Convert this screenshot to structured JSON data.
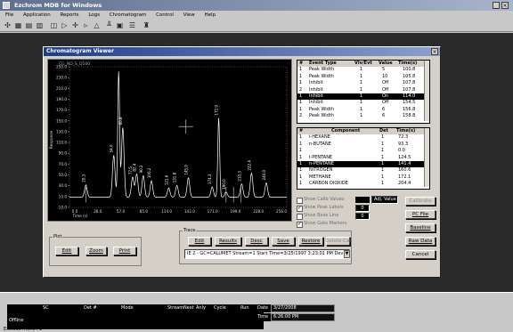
{
  "app": {
    "title": "Ezchrom MDB for Windows",
    "menu": [
      "File",
      "Application",
      "Reports",
      "Logs",
      "Chromatogram",
      "Control",
      "View",
      "Help"
    ]
  },
  "dialog": {
    "title": "Chromatogram Viewer",
    "plot_header": "CG_ND_S_D100",
    "y_label": "Response",
    "x_label": "Time (s)"
  },
  "chart_data": {
    "type": "line",
    "ylim": [
      -10,
      265
    ],
    "xlim": [
      0,
      265
    ],
    "y_ticks": [
      "250.0",
      "230.0",
      "210.0",
      "190.0",
      "170.0",
      "150.0",
      "130.0",
      "110.0",
      "90.0",
      "70.0",
      "50.0",
      "30.0",
      "10.0",
      "-10.0"
    ],
    "x_ticks": [
      "0.0",
      "28.0",
      "57.0",
      "85.0",
      "114.0",
      "142.0",
      "171.0",
      "199.0",
      "228.0",
      "256.0"
    ],
    "peaks": [
      {
        "x": 20,
        "y": 34,
        "label": "20.3"
      },
      {
        "x": 54,
        "y": 92,
        "label": "54.0"
      },
      {
        "x": 60,
        "y": 255,
        "label": ""
      },
      {
        "x": 65,
        "y": 146,
        "label": "60.8"
      },
      {
        "x": 77,
        "y": 49,
        "label": "77.5"
      },
      {
        "x": 82,
        "y": 55,
        "label": "82.4"
      },
      {
        "x": 90,
        "y": 52,
        "label": "90.2"
      },
      {
        "x": 100,
        "y": 42,
        "label": "100.2"
      },
      {
        "x": 121,
        "y": 28,
        "label": "121.6"
      },
      {
        "x": 131,
        "y": 33,
        "label": "131.8"
      },
      {
        "x": 145,
        "y": 48,
        "label": "145.9"
      },
      {
        "x": 174,
        "y": 30,
        "label": "174.3"
      },
      {
        "x": 182,
        "y": 165,
        "label": "172.9"
      },
      {
        "x": 191,
        "y": 20,
        "label": "190.0"
      },
      {
        "x": 210,
        "y": 36,
        "label": "210.3"
      },
      {
        "x": 222,
        "y": 57,
        "label": "222.4"
      },
      {
        "x": 240,
        "y": 38,
        "label": "240.0"
      }
    ],
    "markers_x": [
      20,
      191,
      200,
      209
    ],
    "crosshair": {
      "x": 142,
      "y": 148
    }
  },
  "events": {
    "headers": [
      "#",
      "Event Type",
      "Vlv/Evt",
      "Value",
      "Time(s)"
    ],
    "rows": [
      [
        "1",
        "Peak Width",
        "1",
        "5",
        "100.8"
      ],
      [
        "1",
        "Peak Width",
        "1",
        "10",
        "105.8"
      ],
      [
        "1",
        "Inhibit",
        "1",
        "Off",
        "107.8"
      ],
      [
        "2",
        "Inhibit",
        "1",
        "Off",
        "107.8"
      ],
      [
        "1",
        "Inhibit",
        "1",
        "On",
        "114.0"
      ],
      [
        "1",
        "Inhibit",
        "1",
        "Off",
        "154.5"
      ],
      [
        "1",
        "Peak Width",
        "1",
        "6",
        "156.8"
      ],
      [
        "2",
        "Peak Width",
        "1",
        "6",
        "158.8"
      ]
    ],
    "selected": 4
  },
  "components": {
    "headers": [
      "#",
      "Component",
      "Det",
      "Time(s)"
    ],
    "rows": [
      [
        "1",
        "i-HEXANE",
        "1",
        "72.3"
      ],
      [
        "1",
        "n-BUTANE",
        "1",
        "93.3"
      ],
      [
        "1",
        "",
        "1",
        "0.0"
      ],
      [
        "1",
        "i-PENTANE",
        "1",
        "124.5"
      ],
      [
        "1",
        "n-PENTANE",
        "1",
        "141.4"
      ],
      [
        "1",
        "NITROGEN",
        "1",
        "160.6"
      ],
      [
        "1",
        "METHANE",
        "1",
        "172.1"
      ],
      [
        "1",
        "CARBON DIOXIDE",
        "1",
        "204.4"
      ]
    ],
    "selected": 4
  },
  "options": [
    {
      "label": "Show Calib Values",
      "checked": false
    },
    {
      "label": "Show Peak Labels",
      "checked": true
    },
    {
      "label": "Show Base Line",
      "checked": false
    },
    {
      "label": "Show Gate Markers",
      "checked": true
    }
  ],
  "option_fields": {
    "range_label": "Adj. Value",
    "x_value": "0",
    "y_value": "0"
  },
  "side_buttons": [
    "Calibrate",
    "PC File",
    "Baseline",
    "Raw Data",
    "Cancel"
  ],
  "plot_group": {
    "label": "Plot",
    "buttons": [
      "Edit",
      "Zoom",
      "Print"
    ]
  },
  "trace_group": {
    "label": "Trace",
    "buttons": [
      "Edit",
      "Results",
      "Desc",
      "Save",
      "Restore",
      "Delete Cal"
    ],
    "selector": "IE  2 - GC=CALUMET Stream=1 Start Time=3/25/1997 3:23:01 PM Dev=2"
  },
  "status": {
    "headers": [
      "SC",
      "Det #",
      "Mode",
      "Stream",
      "Next",
      "Anly",
      "Cycle",
      "Run"
    ],
    "mode_value": "Offline",
    "date_label": "Date",
    "date_value": "3/27/2008",
    "time_label": "Time",
    "time_value": "6:26:00 PM",
    "footer": "Exclude menu F1"
  }
}
